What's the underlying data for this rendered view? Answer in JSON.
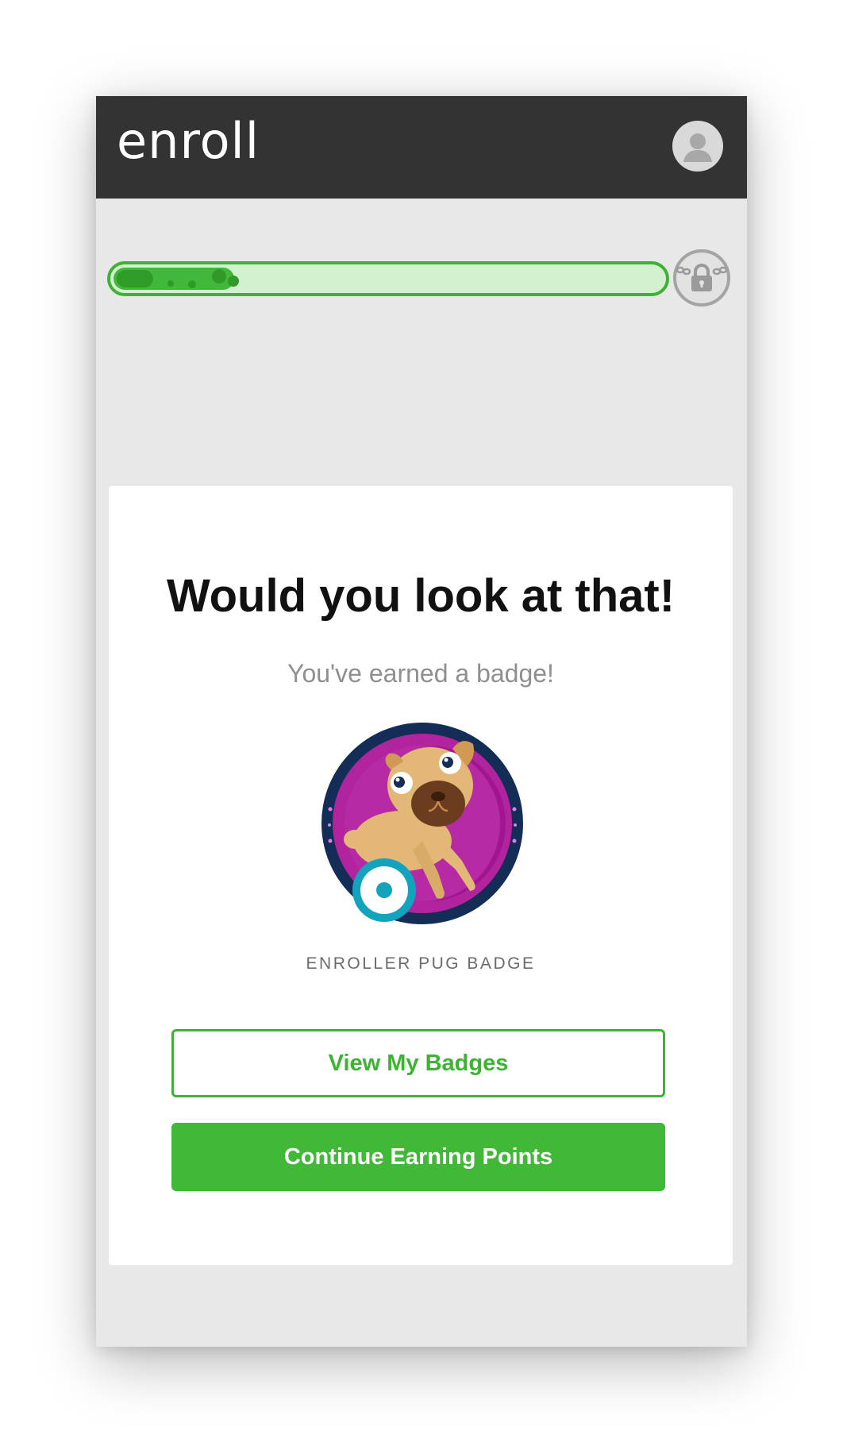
{
  "header": {
    "logo_text": "enroll",
    "avatar_icon": "user-avatar-icon",
    "background": "#333333"
  },
  "progress": {
    "fraction": 0.22,
    "track_color": "#d4f1cf",
    "fill_color": "#42b83a",
    "border_color": "#3db233",
    "end_icon": "lock-icon"
  },
  "card": {
    "headline": "Would you look at that!",
    "subhead": "You've earned a badge!",
    "badge_icon": "pug-badge-icon",
    "badge_label": "ENROLLER PUG BADGE",
    "view_badges_label": "View My Badges",
    "continue_label": "Continue Earning Points"
  },
  "colors": {
    "accent_green": "#41b838",
    "badge_magenta": "#b1249d",
    "badge_navy": "#142d57",
    "badge_teal": "#14a3bd"
  }
}
